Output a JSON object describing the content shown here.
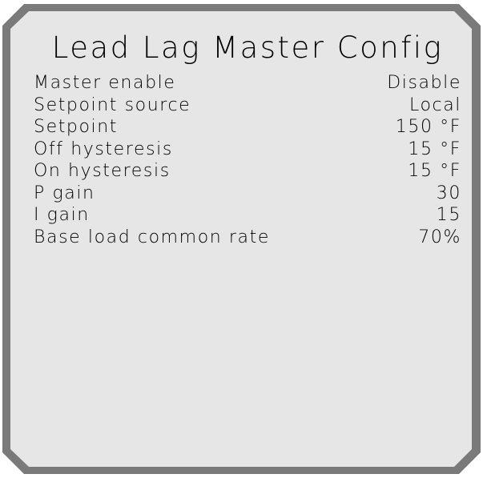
{
  "screen": {
    "title": "Lead Lag Master Config",
    "colors": {
      "frame": "#7a7a7a",
      "panel": "#e6e6e6",
      "text": "#000000"
    },
    "rows": [
      {
        "label": "Master enable",
        "value": "Disable"
      },
      {
        "label": "Setpoint source",
        "value": "Local"
      },
      {
        "label": "Setpoint",
        "value": "150 °F"
      },
      {
        "label": "Off hysteresis",
        "value": "15 °F"
      },
      {
        "label": "On hysteresis",
        "value": "15 °F"
      },
      {
        "label": "P gain",
        "value": "30"
      },
      {
        "label": "I gain",
        "value": "15"
      },
      {
        "label": "Base load common rate",
        "value": "70%"
      }
    ]
  }
}
